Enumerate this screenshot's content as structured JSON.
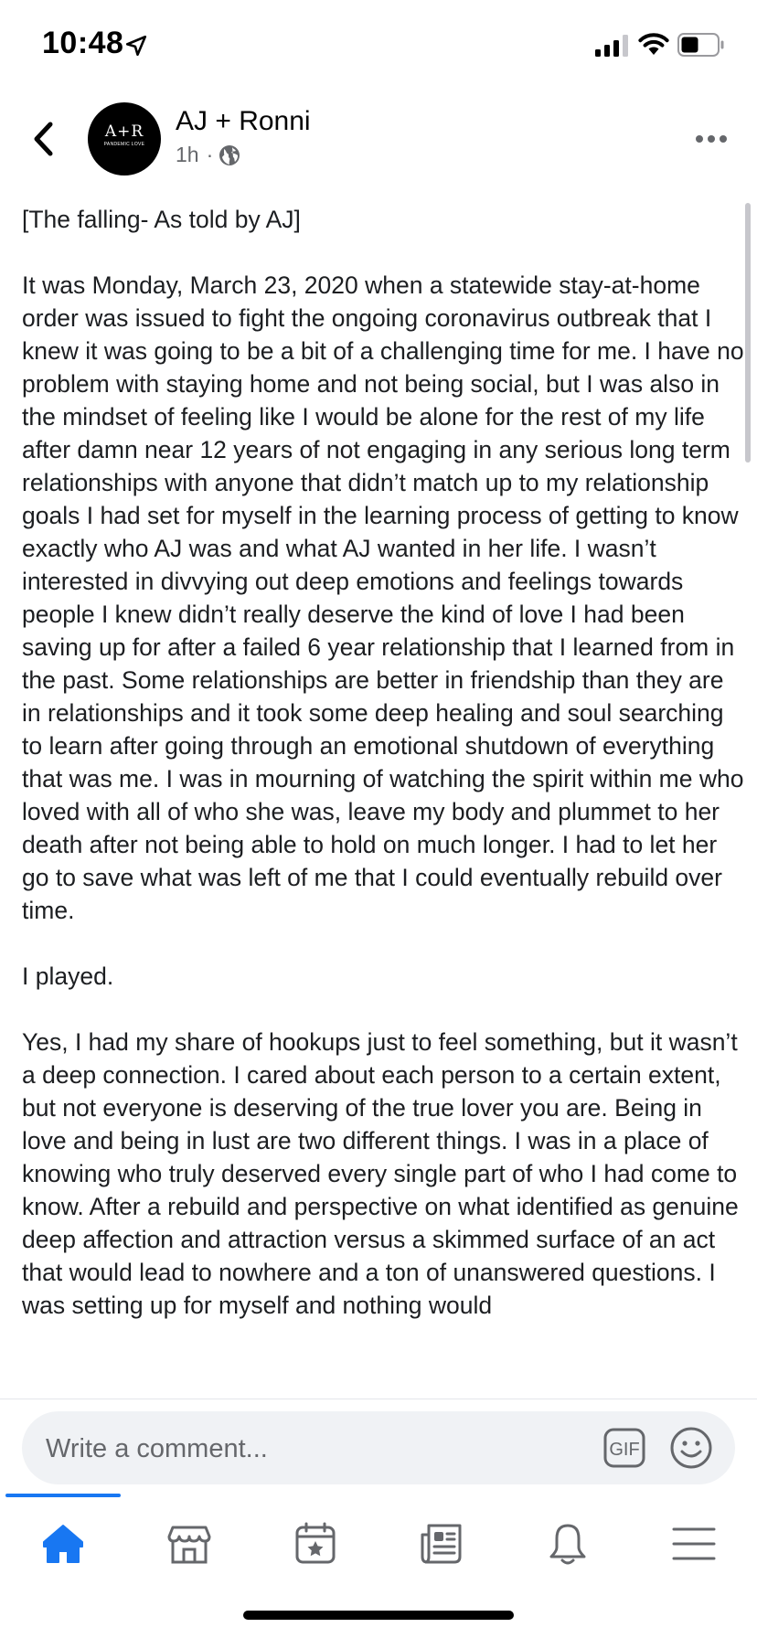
{
  "status_bar": {
    "time": "10:48",
    "icons": [
      "location-arrow-icon",
      "signal-icon",
      "wifi-icon",
      "battery-icon"
    ]
  },
  "post": {
    "page_name": "AJ + Ronni",
    "avatar_mark": "A+R",
    "avatar_sub": "PANDEMIC LOVE",
    "time_ago": "1h",
    "meta_separator": "·",
    "audience_icon": "globe-icon",
    "paragraphs": [
      "[The falling- As told by AJ]",
      "It was Monday, March 23, 2020 when a statewide stay-at-home order was issued to fight the ongoing coronavirus outbreak that I knew it was going to be a bit of a challenging time for me. I have no problem with staying home and not being social, but I was also in the mindset of feeling like I would be alone for the rest of my life after damn near 12 years of not engaging in any serious long term relationships with anyone that didn’t match up to my relationship goals I had set for myself in the learning process of getting to know exactly who AJ was and what AJ wanted in her life. I wasn’t interested in divvying out deep emotions and feelings towards people I knew didn’t really deserve the kind of love I had been saving up for after a failed 6 year relationship that I learned from in the past. Some relationships are better in friendship than they are in relationships and it took some deep healing and soul searching to learn after going through an emotional shutdown of everything that was me. I was in mourning of watching the spirit within me who loved with all of who she was, leave my body and plummet to her death after not being able to hold on much longer. I had to let her go to save what was left of me that I could eventually rebuild over time.",
      "I played.",
      "Yes, I had my share of hookups just to feel something, but it wasn’t a deep connection. I cared about each person to a certain extent, but not everyone is deserving of the true lover you are. Being in love and being in lust are two different things. I was in a place of knowing who truly deserved every single part of who I had come to know. After a rebuild and perspective on what identified as genuine deep affection and attraction versus a skimmed surface of an act that would lead to nowhere and a ton of unanswered questions. I was setting up for myself and nothing would"
    ]
  },
  "composer": {
    "placeholder": "Write a comment...",
    "gif_label": "GIF"
  },
  "tabs": [
    {
      "name": "home",
      "icon": "home-icon",
      "active": true
    },
    {
      "name": "marketplace",
      "icon": "marketplace-icon",
      "active": false
    },
    {
      "name": "events",
      "icon": "events-icon",
      "active": false
    },
    {
      "name": "news",
      "icon": "news-icon",
      "active": false
    },
    {
      "name": "notifications",
      "icon": "bell-icon",
      "active": false
    },
    {
      "name": "menu",
      "icon": "menu-icon",
      "active": false
    }
  ],
  "colors": {
    "accent": "#1877f2",
    "inactive_icon": "#65676b",
    "composer_bg": "#f0f2f5",
    "meta_text": "#65676b"
  }
}
